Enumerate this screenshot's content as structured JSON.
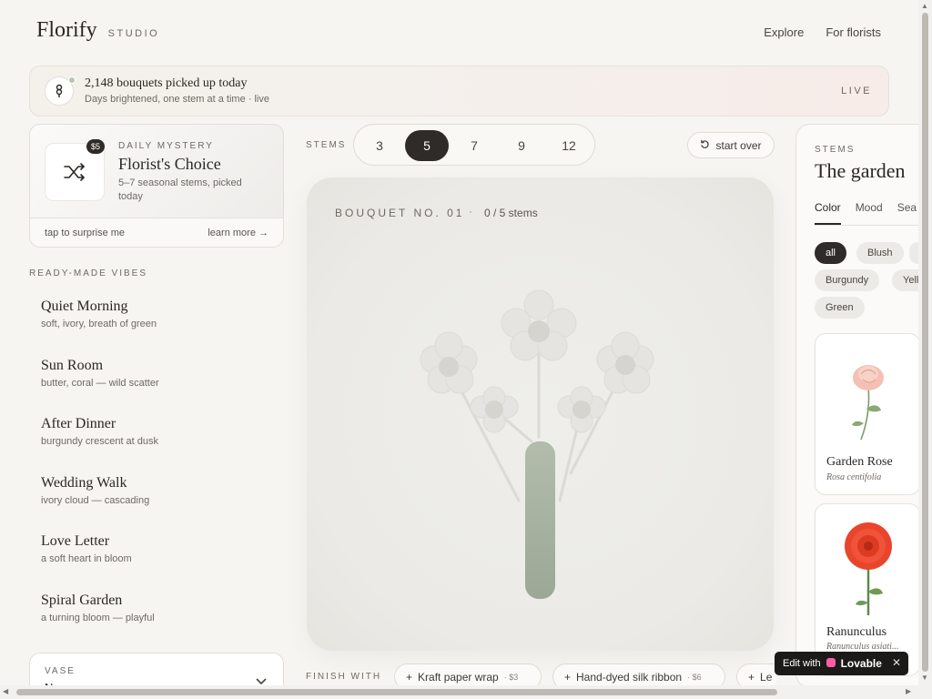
{
  "header": {
    "logo": "Florify",
    "sub": "STUDIO",
    "nav": [
      "Explore",
      "For florists"
    ]
  },
  "banner": {
    "headline": "2,148 bouquets picked up today",
    "tagline": "Days brightened, one stem at a time · live",
    "live": "LIVE"
  },
  "mystery": {
    "price": "$5",
    "kicker": "DAILY MYSTERY",
    "title": "Florist's Choice",
    "desc": "5–7 seasonal stems, picked today",
    "cta": "tap to surprise me",
    "learn": "learn more →"
  },
  "vibes": {
    "heading": "READY-MADE VIBES",
    "items": [
      {
        "name": "Quiet Morning",
        "desc": "soft, ivory, breath of green"
      },
      {
        "name": "Sun Room",
        "desc": "butter, coral — wild scatter"
      },
      {
        "name": "After Dinner",
        "desc": "burgundy crescent at dusk"
      },
      {
        "name": "Wedding Walk",
        "desc": "ivory cloud — cascading"
      },
      {
        "name": "Love Letter",
        "desc": "a soft heart in bloom"
      },
      {
        "name": "Spiral Garden",
        "desc": "a turning bloom — playful"
      }
    ]
  },
  "vase": {
    "label": "VASE",
    "value": "No vase"
  },
  "stems": {
    "label": "STEMS",
    "options": [
      "3",
      "5",
      "7",
      "9",
      "12"
    ],
    "selected": "5",
    "start_over": "start over"
  },
  "bouquet": {
    "caption": "BOUQUET NO. 01",
    "sep": "·",
    "count": "0 / 5 stems"
  },
  "finish": {
    "label": "FINISH WITH",
    "items": [
      {
        "name": "Kraft paper wrap",
        "price": "· $3"
      },
      {
        "name": "Hand-dyed silk ribbon",
        "price": "· $6"
      },
      {
        "name": "Le",
        "price": ""
      }
    ]
  },
  "garden": {
    "kicker": "STEMS",
    "title": "The garden",
    "tabs": [
      "Color",
      "Mood",
      "Sea"
    ],
    "active_tab": "Color",
    "chips": [
      "all",
      "Blush",
      "Burgundy",
      "Yello",
      "Green"
    ],
    "selected_chip": "all",
    "flowers": [
      {
        "name": "Garden Rose",
        "latin": "Rosa centifolia"
      },
      {
        "name": "Ranunculus",
        "latin": "Ranunculus asiati..."
      }
    ]
  },
  "badge": {
    "prefix": "Edit with",
    "brand": "Lovable",
    "close": "✕"
  },
  "colors": {
    "ink": "#2f2b28",
    "accent_green": "#8d9c86",
    "paper": "#f7f5f1"
  }
}
